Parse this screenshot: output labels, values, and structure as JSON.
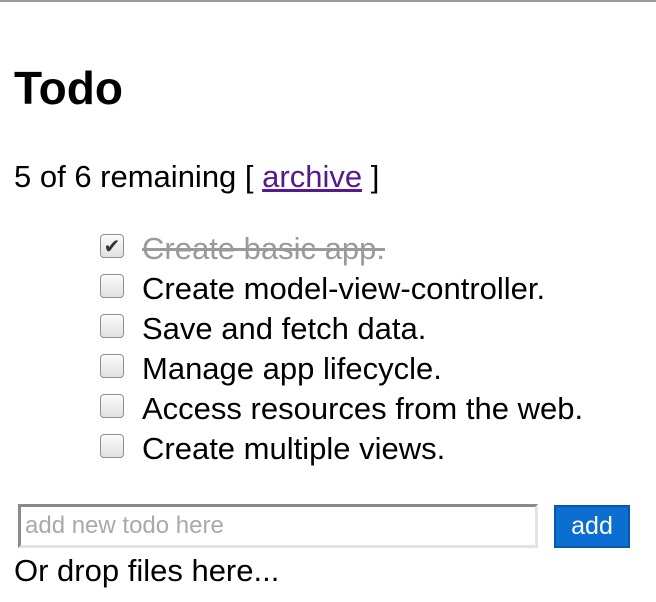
{
  "header": {
    "title": "Todo"
  },
  "summary": {
    "prefix": "5 of 6 remaining [ ",
    "archive_label": "archive",
    "suffix": " ]"
  },
  "todos": [
    {
      "text": "Create basic app.",
      "done": true
    },
    {
      "text": "Create model-view-controller.",
      "done": false
    },
    {
      "text": "Save and fetch data.",
      "done": false
    },
    {
      "text": "Manage app lifecycle.",
      "done": false
    },
    {
      "text": "Access resources from the web.",
      "done": false
    },
    {
      "text": "Create multiple views.",
      "done": false
    }
  ],
  "new_todo": {
    "placeholder": "add new todo here",
    "value": "",
    "add_label": "add"
  },
  "drop_hint": "Or drop files here...",
  "colors": {
    "link": "#551a8b",
    "button_bg": "#0b6fd1",
    "done_text": "#9a9a9a"
  }
}
